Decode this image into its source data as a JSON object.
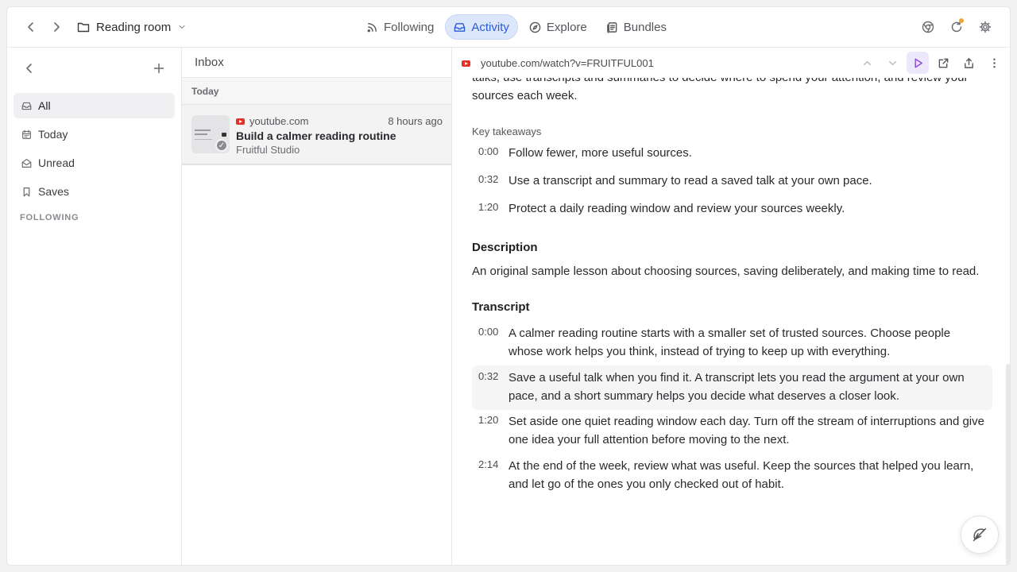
{
  "header": {
    "folder_title": "Reading room",
    "tabs": [
      {
        "label": "Following",
        "icon": "rss-icon"
      },
      {
        "label": "Activity",
        "icon": "inbox-icon",
        "active": true
      },
      {
        "label": "Explore",
        "icon": "compass-icon"
      },
      {
        "label": "Bundles",
        "icon": "bundle-icon"
      }
    ],
    "notification_color": "#f0a531"
  },
  "sidebar": {
    "items": [
      {
        "label": "All",
        "icon": "inbox-icon",
        "active": true
      },
      {
        "label": "Today",
        "icon": "calendar-icon"
      },
      {
        "label": "Unread",
        "icon": "mail-open-icon"
      },
      {
        "label": "Saves",
        "icon": "bookmark-icon"
      }
    ],
    "section_heading": "FOLLOWING"
  },
  "inbox": {
    "title": "Inbox",
    "group_label": "Today",
    "item": {
      "source": "youtube.com",
      "time": "8 hours ago",
      "title": "Build a calmer reading routine",
      "author": "Fruitful Studio"
    }
  },
  "reader": {
    "url": "youtube.com/watch?v=FRUITFUL001",
    "intro_line1": "talks, use transcripts and summaries to decide where to spend your attention, and review your",
    "intro_line2": "sources each week.",
    "key_takeaways_label": "Key takeaways",
    "takeaways": [
      {
        "time": "0:00",
        "text": "Follow fewer, more useful sources."
      },
      {
        "time": "0:32",
        "text": "Use a transcript and summary to read a saved talk at your own pace."
      },
      {
        "time": "1:20",
        "text": "Protect a daily reading window and review your sources weekly."
      }
    ],
    "description_heading": "Description",
    "description": "An original sample lesson about choosing sources, saving deliberately, and making time to read.",
    "transcript_heading": "Transcript",
    "transcript": [
      {
        "time": "0:00",
        "text": "A calmer reading routine starts with a smaller set of trusted sources. Choose people whose work helps you think, instead of trying to keep up with everything."
      },
      {
        "time": "0:32",
        "text": "Save a useful talk when you find it. A transcript lets you read the argument at your own pace, and a short summary helps you decide what deserves a closer look.",
        "highlighted": true
      },
      {
        "time": "1:20",
        "text": "Set aside one quiet reading window each day. Turn off the stream of interruptions and give one idea your full attention before moving to the next."
      },
      {
        "time": "2:14",
        "text": "At the end of the week, review what was useful. Keep the sources that helped you learn, and let go of the ones you only checked out of habit."
      }
    ]
  },
  "colors": {
    "accent": "#2b5bd7",
    "accent_bg": "#dde7fb",
    "play_accent": "#8b45d6",
    "youtube_red": "#e5312a"
  }
}
